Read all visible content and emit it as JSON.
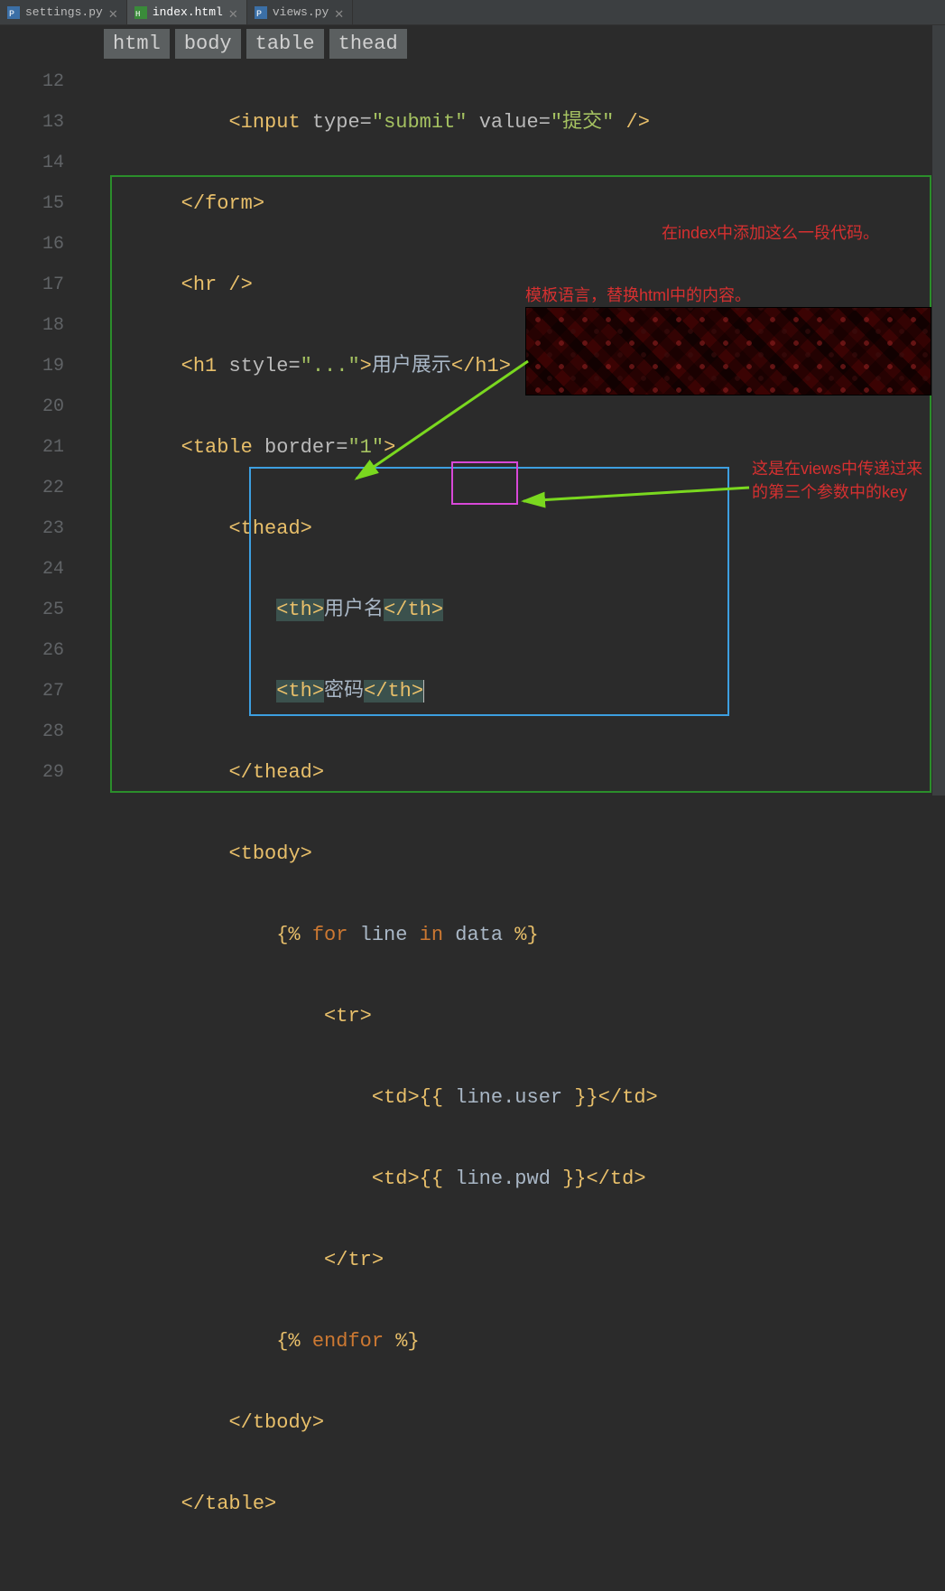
{
  "tabs": [
    {
      "label": "settings.py",
      "icon": "py",
      "active": false
    },
    {
      "label": "index.html",
      "icon": "html",
      "active": true
    },
    {
      "label": "views.py",
      "icon": "py",
      "active": false
    }
  ],
  "breadcrumbs": [
    "html",
    "body",
    "table",
    "thead"
  ],
  "line_numbers": [
    "12",
    "13",
    "14",
    "15",
    "16",
    "17",
    "18",
    "19",
    "20",
    "21",
    "22",
    "23",
    "24",
    "25",
    "26",
    "27",
    "28",
    "29"
  ],
  "code": {
    "l12": {
      "pre": "            ",
      "t1": "<input ",
      "a1": "type=",
      "v1": "\"submit\"",
      "sp1": " ",
      "a2": "value=",
      "v2": "\"提交\"",
      "sp2": " ",
      "t2": "/>"
    },
    "l13": {
      "pre": "        ",
      "t": "</form>"
    },
    "l14": {
      "pre": "        ",
      "t": "<hr />"
    },
    "l15": {
      "pre": "        ",
      "t1": "<h1 ",
      "a": "style=",
      "v": "\"...\"",
      "t2": ">",
      "txt": "用户展示",
      "t3": "</h1>"
    },
    "l16": {
      "pre": "        ",
      "t1": "<table ",
      "a": "border=",
      "v": "\"1\"",
      "t2": ">"
    },
    "l17": {
      "pre": "            ",
      "t": "<thead>"
    },
    "l18": {
      "pre": "                ",
      "t1": "<th>",
      "txt": "用户名",
      "t2": "</th>"
    },
    "l19": {
      "pre": "                ",
      "t1": "<th>",
      "txt": "密码",
      "t2": "</th>"
    },
    "l20": {
      "pre": "            ",
      "t": "</thead>"
    },
    "l21": {
      "pre": "            ",
      "t": "<tbody>"
    },
    "l22": {
      "pre": "                ",
      "d1": "{% ",
      "k1": "for ",
      "v1": "line ",
      "k2": "in ",
      "v2": "data ",
      "d2": "%}"
    },
    "l23": {
      "pre": "                    ",
      "t": "<tr>"
    },
    "l24": {
      "pre": "                        ",
      "t1": "<td>",
      "d1": "{{ ",
      "v": "line.user ",
      "d2": "}}",
      "t2": "</td>"
    },
    "l25": {
      "pre": "                        ",
      "t1": "<td>",
      "d1": "{{ ",
      "v": "line.pwd ",
      "d2": "}}",
      "t2": "</td>"
    },
    "l26": {
      "pre": "                    ",
      "t": "</tr>"
    },
    "l27": {
      "pre": "                ",
      "d1": "{% ",
      "k": "endfor ",
      "d2": "%}"
    },
    "l28": {
      "pre": "            ",
      "t": "</tbody>"
    },
    "l29": {
      "pre": "        ",
      "t": "</table>"
    }
  },
  "annotations": {
    "note_top_right": "在index中添加这么一段代码。",
    "note_mosaic": "模板语言，替换html中的内容。",
    "note_data_key": "这是在views中传递过来的第三个参数中的key"
  }
}
